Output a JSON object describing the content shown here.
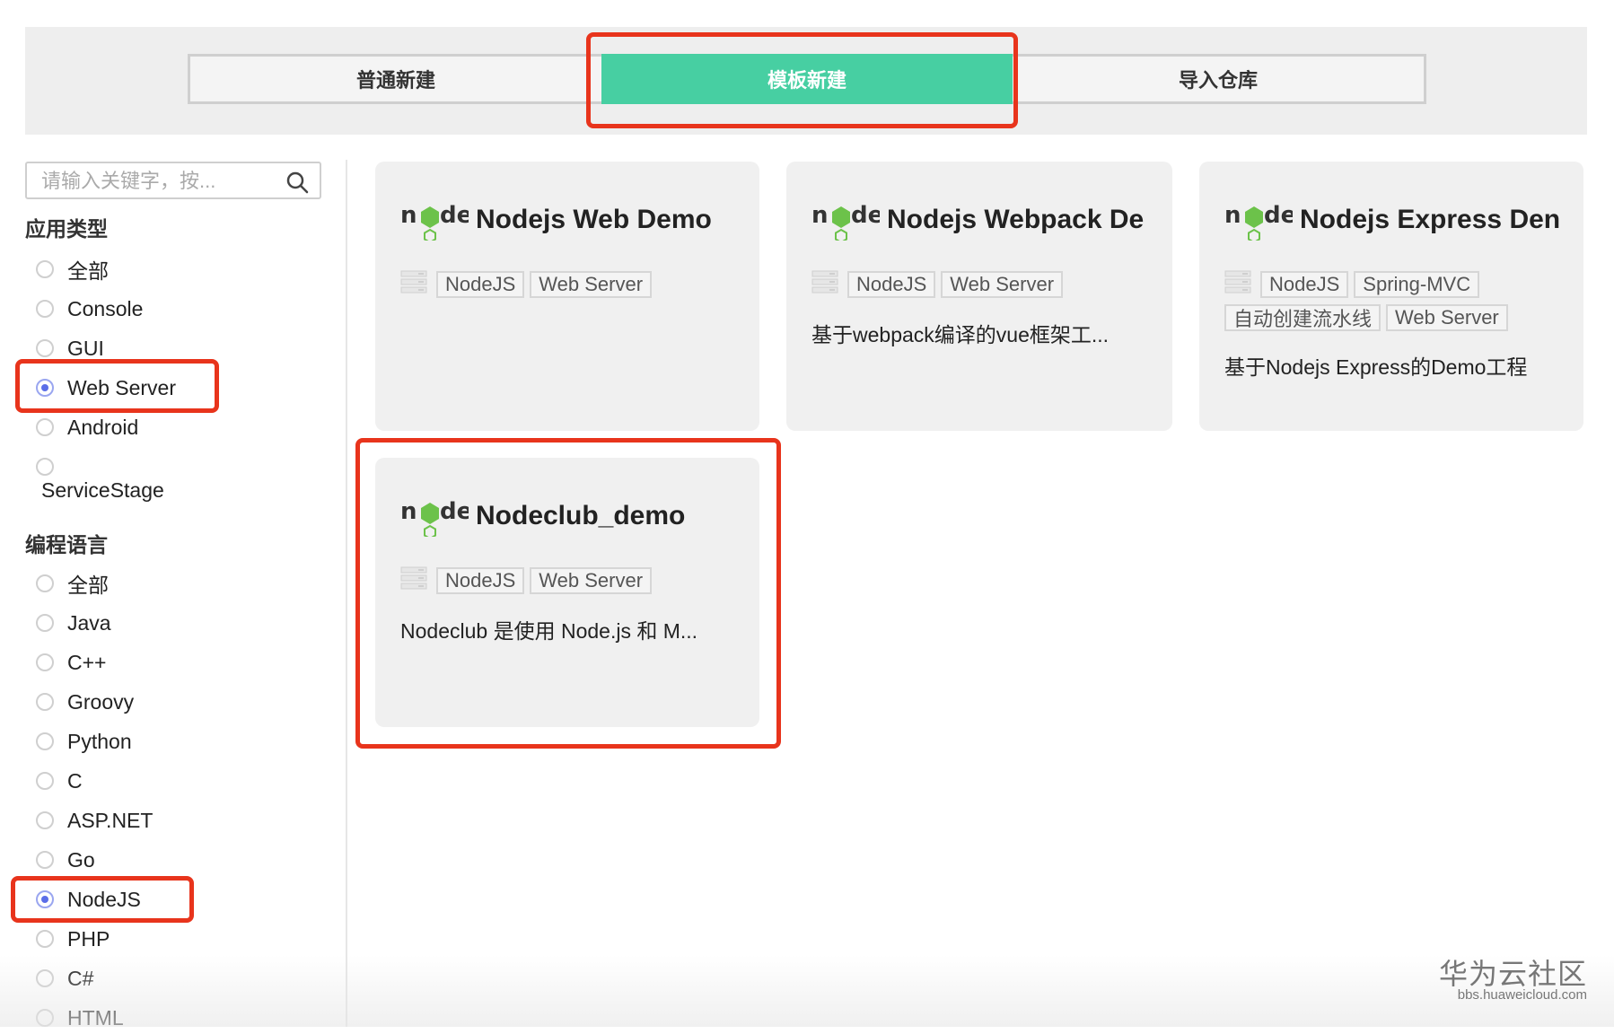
{
  "tabs": [
    {
      "label": "普通新建",
      "active": false
    },
    {
      "label": "模板新建",
      "active": true
    },
    {
      "label": "导入仓库",
      "active": false
    }
  ],
  "search": {
    "placeholder": "请输入关键字，按..."
  },
  "app_type": {
    "title": "应用类型",
    "options": [
      "全部",
      "Console",
      "GUI",
      "Web Server",
      "Android",
      "ServiceStage"
    ],
    "selected": "Web Server"
  },
  "language": {
    "title": "编程语言",
    "options": [
      "全部",
      "Java",
      "C++",
      "Groovy",
      "Python",
      "C",
      "ASP.NET",
      "Go",
      "NodeJS",
      "PHP",
      "C#",
      "HTML"
    ],
    "selected": "NodeJS"
  },
  "cards": [
    {
      "title": "Nodejs Web Demo",
      "tags": [
        "NodeJS",
        "Web Server"
      ],
      "desc": ""
    },
    {
      "title": "Nodejs Webpack De",
      "tags": [
        "NodeJS",
        "Web Server"
      ],
      "desc": "基于webpack编译的vue框架工..."
    },
    {
      "title": "Nodejs Express Den",
      "tags": [
        "NodeJS",
        "Spring-MVC",
        "自动创建流水线",
        "Web Server"
      ],
      "desc": "基于Nodejs Express的Demo工程"
    },
    {
      "title": "Nodeclub_demo",
      "tags": [
        "NodeJS",
        "Web Server"
      ],
      "desc": "Nodeclub 是使用 Node.js 和 M..."
    }
  ],
  "logo_text": "node",
  "watermark": {
    "main": "华为云社区",
    "sub": "bbs.huaweicloud.com"
  },
  "colors": {
    "accent": "#47cfa2",
    "highlight": "#e8341c",
    "radio_selected": "#5b6ee8",
    "node_green": "#6cc24a"
  }
}
